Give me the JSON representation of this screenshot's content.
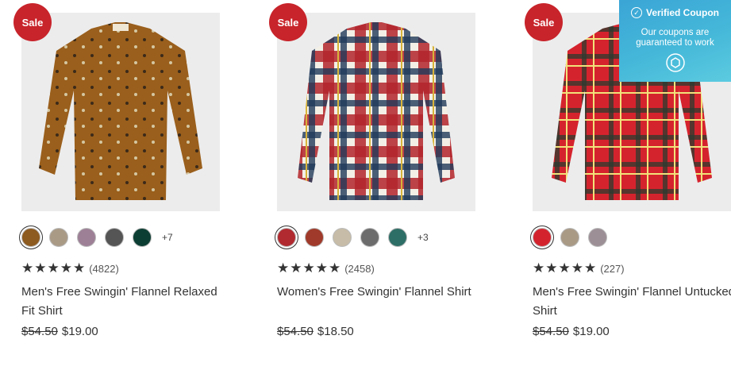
{
  "coupon": {
    "title": "Verified Coupon",
    "body": "Our coupons are guaranteed to work",
    "icon": "shield-icon"
  },
  "products": [
    {
      "badge": "Sale",
      "colors": [
        "#8d5a1f",
        "#a99a86",
        "#9d7f96",
        "#555555",
        "#0d3e33"
      ],
      "more": "+7",
      "stars": "★★★★★",
      "review_count": "(4822)",
      "title": "Men's Free Swingin' Flannel Relaxed Fit Shirt",
      "old_price": "$54.50",
      "price": "$19.00"
    },
    {
      "badge": "Sale",
      "colors": [
        "#b02a30",
        "#a03a2a",
        "#c7bca7",
        "#6c6c6c",
        "#2d6e66"
      ],
      "more": "+3",
      "stars": "★★★★★",
      "review_count": "(2458)",
      "title": "Women's Free Swingin' Flannel Shirt",
      "old_price": "$54.50",
      "price": "$18.50"
    },
    {
      "badge": "Sale",
      "colors": [
        "#d3242e",
        "#a99a86",
        "#9d8f96"
      ],
      "more": "",
      "stars": "★★★★★",
      "review_count": "(227)",
      "title": "Men's Free Swingin' Flannel Untucked Shirt",
      "old_price": "$54.50",
      "price": "$19.00"
    }
  ]
}
